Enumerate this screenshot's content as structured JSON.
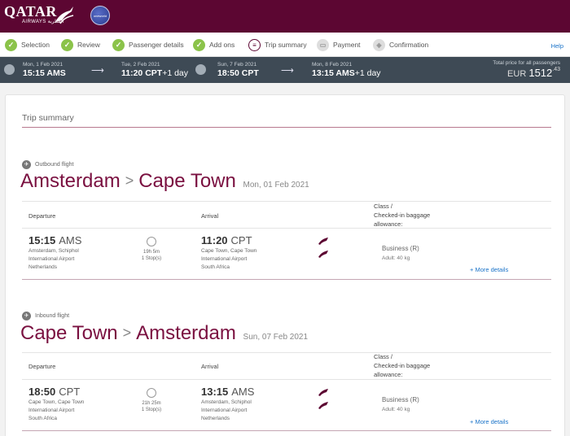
{
  "brand": {
    "name": "QATAR",
    "sub": "AIRWAYS القطرية",
    "alliance": "oneworld",
    "primary_color": "#5c0632"
  },
  "steps": [
    {
      "label": "Selection",
      "state": "done"
    },
    {
      "label": "Review",
      "state": "done"
    },
    {
      "label": "Passenger details",
      "state": "done"
    },
    {
      "label": "Add ons",
      "state": "done"
    },
    {
      "label": "Trip summary",
      "state": "current"
    },
    {
      "label": "Payment",
      "state": "todo"
    },
    {
      "label": "Confirmation",
      "state": "todo"
    }
  ],
  "help_label": "Help",
  "flight_bar": {
    "segments": [
      {
        "date": "Mon, 1 Feb 2021",
        "time": "15:15 AMS",
        "plus": ""
      },
      {
        "date": "Tue, 2 Feb 2021",
        "time": "11:20 CPT",
        "plus": "+1 day"
      },
      {
        "date": "Sun, 7 Feb 2021",
        "time": "18:50 CPT",
        "plus": ""
      },
      {
        "date": "Mon, 8 Feb 2021",
        "time": "13:15 AMS",
        "plus": "+1 day"
      }
    ],
    "total_label": "Total price for all passengers",
    "currency": "EUR",
    "amount": "1512",
    "cents": ".43"
  },
  "trip_summary_title": "Trip summary",
  "columns": {
    "departure": "Departure",
    "arrival": "Arrival",
    "class_line1": "Class /",
    "class_line2": "Checked-in baggage",
    "class_line3": "allowance:"
  },
  "outbound": {
    "label": "Outbound flight",
    "from": "Amsterdam",
    "to": "Cape Town",
    "date": "Mon, 01 Feb 2021",
    "dep_time": "15:15",
    "dep_code": "AMS",
    "dep_loc1": "Amsterdam, Schiphol",
    "dep_loc2": "International Airport",
    "dep_loc3": "Netherlands",
    "duration": "19h 5m",
    "stops": "1 Stop(s)",
    "arr_time": "11:20",
    "arr_code": "CPT",
    "arr_loc1": "Cape Town, Cape Town",
    "arr_loc2": "International Airport",
    "arr_loc3": "South Africa",
    "class": "Business (R)",
    "baggage": "Adult: 40 kg",
    "more": "+ More details"
  },
  "inbound": {
    "label": "Inbound flight",
    "from": "Cape Town",
    "to": "Amsterdam",
    "date": "Sun, 07 Feb 2021",
    "dep_time": "18:50",
    "dep_code": "CPT",
    "dep_loc1": "Cape Town, Cape Town",
    "dep_loc2": "International Airport",
    "dep_loc3": "South Africa",
    "duration": "21h 25m",
    "stops": "1 Stop(s)",
    "arr_time": "13:15",
    "arr_code": "AMS",
    "arr_loc1": "Amsterdam, Schiphol",
    "arr_loc2": "International Airport",
    "arr_loc3": "Netherlands",
    "class": "Business (R)",
    "baggage": "Adult: 40 kg",
    "more": "+ More details"
  }
}
